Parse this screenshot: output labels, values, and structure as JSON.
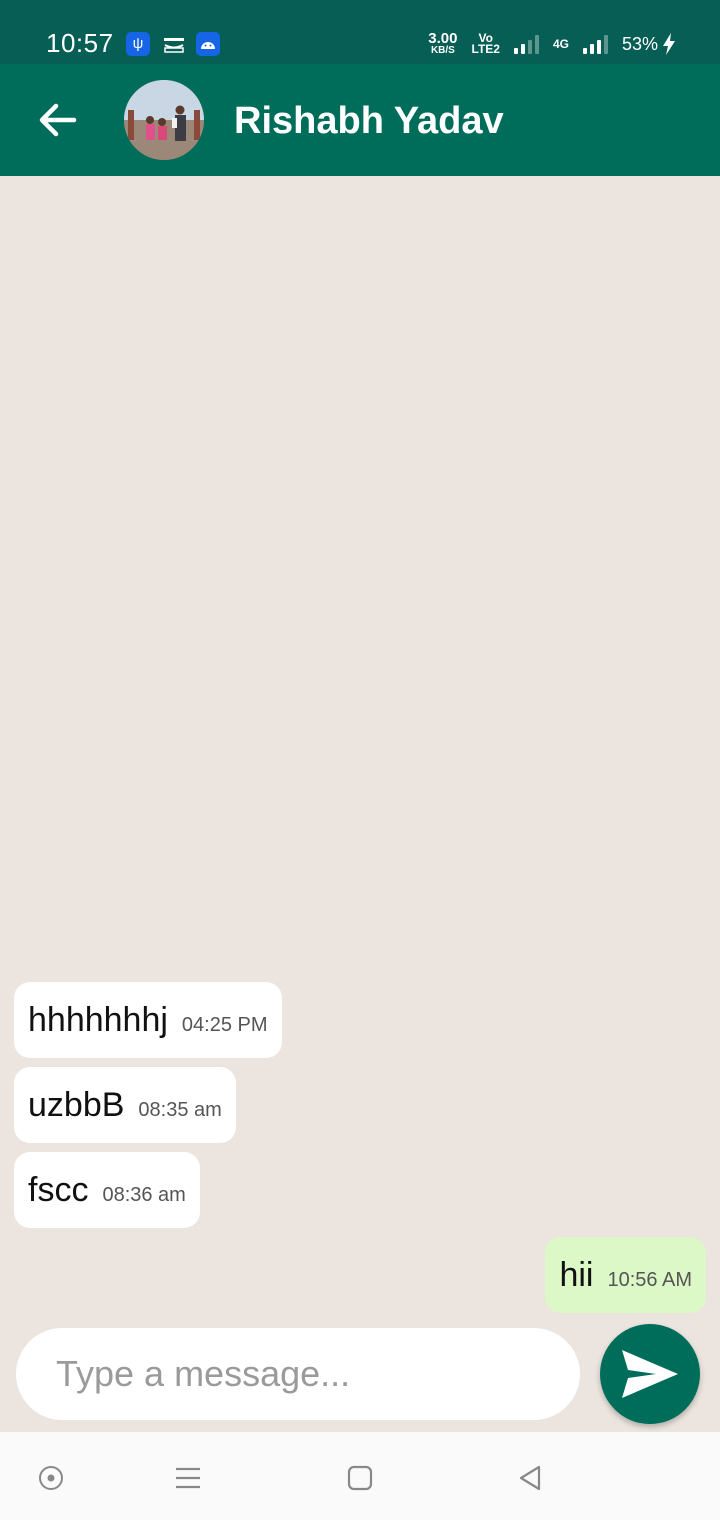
{
  "status_bar": {
    "time": "10:57",
    "network_speed": "3.00",
    "network_speed_unit": "KB/S",
    "volte": "Vo",
    "volte_sub": "LTE2",
    "network_type": "4G",
    "battery": "53%",
    "notification_icons": [
      "usb-icon",
      "amazon-icon",
      "android-icon"
    ]
  },
  "header": {
    "contact_name": "Rishabh Yadav",
    "color": "#006d5b"
  },
  "messages": [
    {
      "direction": "in",
      "text": "hhhhhhhj",
      "time": "04:25 PM"
    },
    {
      "direction": "in",
      "text": "uzbbB",
      "time": "08:35 am"
    },
    {
      "direction": "in",
      "text": "fscc",
      "time": "08:36 am"
    },
    {
      "direction": "out",
      "text": "hii",
      "time": "10:56 AM"
    }
  ],
  "composer": {
    "placeholder": "Type a message...",
    "value": ""
  },
  "colors": {
    "chat_background": "#ece5df",
    "incoming_bubble": "#ffffff",
    "outgoing_bubble": "#dcf8c6",
    "accent": "#006d5b"
  }
}
